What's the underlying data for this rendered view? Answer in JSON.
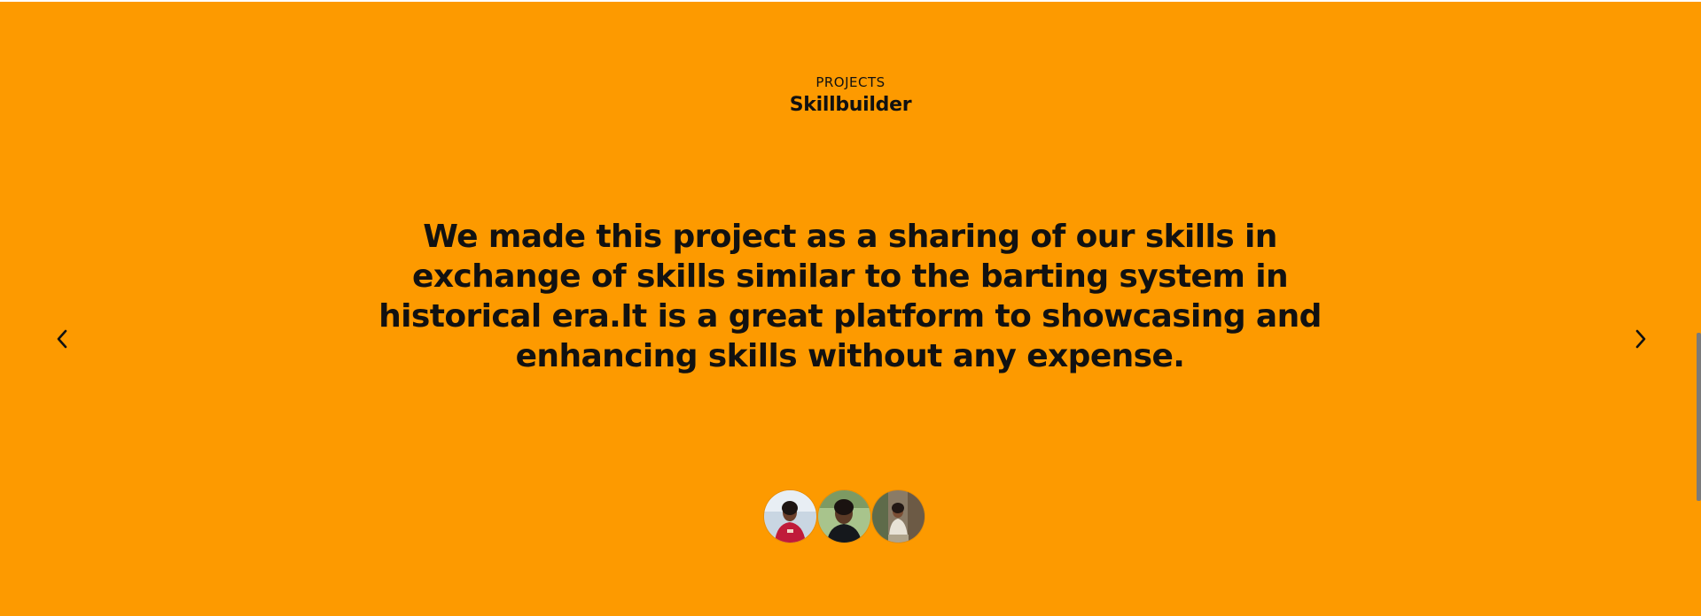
{
  "section": {
    "eyebrow": "PROJECTS",
    "title": "Skillbuilder",
    "quote": "We made this project as a sharing of our skills in exchange of skills similar to the barting system in historical era.It is a great platform to showcasing and enhancing skills without any expense."
  },
  "navigation": {
    "prev_icon": "chevron-left-icon",
    "next_icon": "chevron-right-icon"
  },
  "avatars": [
    {
      "id": "member-1"
    },
    {
      "id": "member-2"
    },
    {
      "id": "member-3"
    }
  ],
  "colors": {
    "background": "#fd9a00",
    "text": "#111111"
  }
}
